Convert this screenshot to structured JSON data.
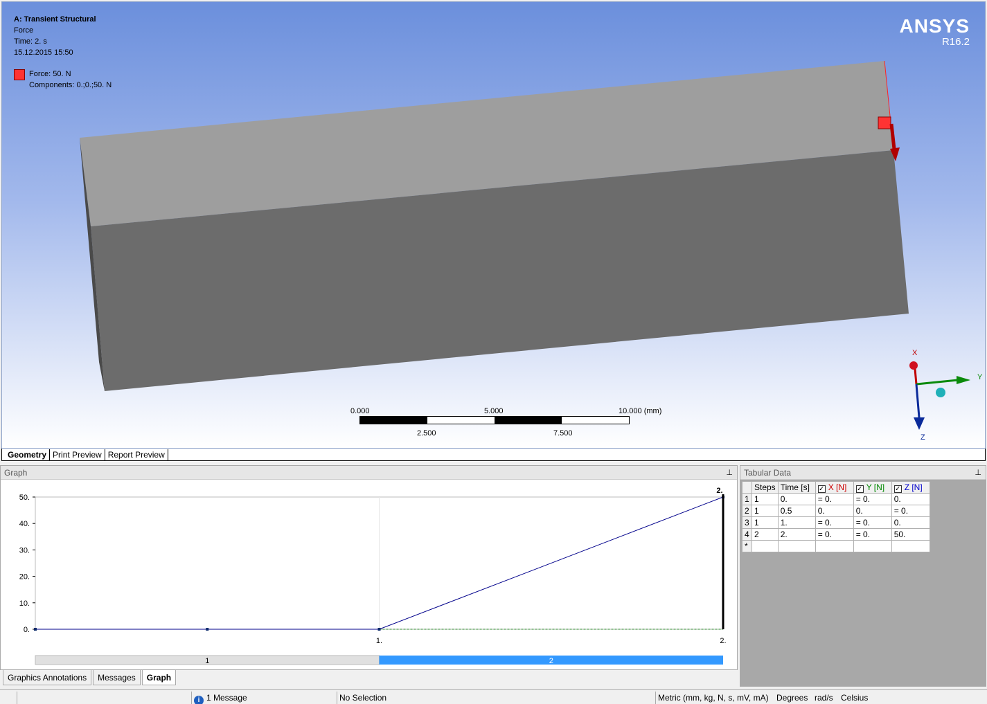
{
  "viewport": {
    "analysis_title": "A: Transient Structural",
    "object_name": "Force",
    "time_label": "Time: 2. s",
    "date_label": "15.12.2015 15:50",
    "legend_force": "Force: 50. N",
    "legend_components": "Components: 0.;0.;50. N",
    "legend_color": "#ff3333",
    "brand_name": "ANSYS",
    "brand_version": "R16.2",
    "scale_labels": {
      "a": "0.000",
      "b": "5.000",
      "c": "10.000 (mm)",
      "d": "2.500",
      "e": "7.500"
    },
    "axes": {
      "x": "X",
      "y": "Y",
      "z": "Z"
    }
  },
  "view_tabs": [
    "Geometry",
    "Print Preview",
    "Report Preview"
  ],
  "graph": {
    "header": "Graph",
    "pin": "p",
    "peak_label": "2."
  },
  "chart_data": {
    "type": "line",
    "x": [
      0,
      0.5,
      1,
      2
    ],
    "series": [
      {
        "values": [
          0,
          0,
          0,
          50
        ]
      }
    ],
    "ylim": [
      0,
      50
    ],
    "xlim": [
      0,
      2
    ],
    "yticks": [
      "0.",
      "10.",
      "20.",
      "30.",
      "40.",
      "50."
    ],
    "xticks": [
      "1.",
      "2."
    ],
    "steps": [
      "1",
      "2"
    ],
    "line_color": "#00008b",
    "step_active_color": "#3399ff"
  },
  "bottom_tabs": [
    "Graphics Annotations",
    "Messages",
    "Graph"
  ],
  "tabular": {
    "header": "Tabular Data",
    "columns": [
      "Steps",
      "Time [s]",
      "X [N]",
      "Y [N]",
      "Z [N]"
    ],
    "rows": [
      [
        "1",
        "1",
        "0.",
        "= 0.",
        "= 0.",
        "0."
      ],
      [
        "2",
        "1",
        "0.5",
        "0.",
        "0.",
        "= 0."
      ],
      [
        "3",
        "1",
        "1.",
        "= 0.",
        "= 0.",
        "0."
      ],
      [
        "4",
        "2",
        "2.",
        "= 0.",
        "= 0.",
        "50."
      ],
      [
        "*",
        "",
        "",
        "",
        "",
        ""
      ]
    ],
    "col_colors": {
      "x": "#cc0000",
      "y": "#008800",
      "z": "#0000cc"
    }
  },
  "status": {
    "messages": "1 Message",
    "selection": "No Selection",
    "units": "Metric (mm, kg, N, s, mV, mA)",
    "angle": "Degrees",
    "rate": "rad/s",
    "temp": "Celsius"
  }
}
